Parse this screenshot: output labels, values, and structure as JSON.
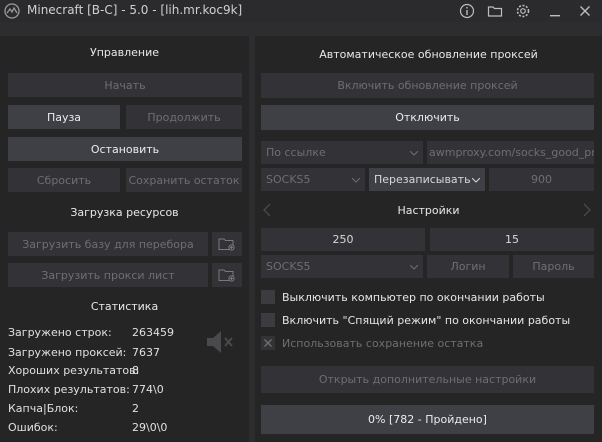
{
  "window": {
    "title": "Minecraft [B-C] - 5.0 - [lih.mr.koc9k]",
    "icons": [
      "logo-icon",
      "info-icon",
      "folder-icon",
      "settings-icon",
      "minimize-icon",
      "close-icon"
    ]
  },
  "control": {
    "title": "Управление",
    "start": "Начать",
    "pause": "Пауза",
    "resume": "Продолжить",
    "stop": "Остановить",
    "reset": "Сбросить",
    "save_rest": "Сохранить остаток"
  },
  "resources": {
    "title": "Загрузка ресурсов",
    "load_base": "Загрузить базу для перебора",
    "load_proxy": "Загрузить прокси лист"
  },
  "stats": {
    "title": "Статистика",
    "rows": [
      {
        "label": "Загружено строк:",
        "value": "263459"
      },
      {
        "label": "Загружено проксей:",
        "value": "7637"
      },
      {
        "label": "Хороших результатов:",
        "value": "8"
      },
      {
        "label": "Плохих результатов:",
        "value": "774\\0"
      },
      {
        "label": "Капча|Блок:",
        "value": "2"
      },
      {
        "label": "Ошибок:",
        "value": "29\\0\\0"
      }
    ],
    "sound_icon": "sound-muted-icon"
  },
  "proxy_update": {
    "title": "Автоматическое обновление проксей",
    "enable": "Включить обновление проксей",
    "disable": "Отключить",
    "source": "По ссылке",
    "url": "awmproxy.com/socks_good_pro",
    "type": "SOCKS5",
    "mode": "Перезаписывать",
    "interval": "900"
  },
  "settings": {
    "title": "Настройки",
    "threads": "250",
    "timeout": "15",
    "proxy_type": "SOCKS5",
    "login_placeholder": "Логин",
    "password_placeholder": "Пароль",
    "checkboxes": [
      {
        "label": "Выключить компьютер по окончании работы",
        "checked": false,
        "enabled": true
      },
      {
        "label": "Включить \"Спящий режим\" по окончании работы",
        "checked": false,
        "enabled": true
      },
      {
        "label": "Использовать сохранение остатка",
        "checked": true,
        "enabled": false
      }
    ],
    "more_settings": "Открыть дополнительные настройки"
  },
  "progress": {
    "text": "0% [782 - Пройдено]",
    "value": 0
  },
  "colors": {
    "background": "#2d2d30",
    "panel": "#252526",
    "button": "#333337",
    "button_active": "#3f3f46",
    "text": "#e6e6e6",
    "text_disabled": "#6f6f6f"
  }
}
